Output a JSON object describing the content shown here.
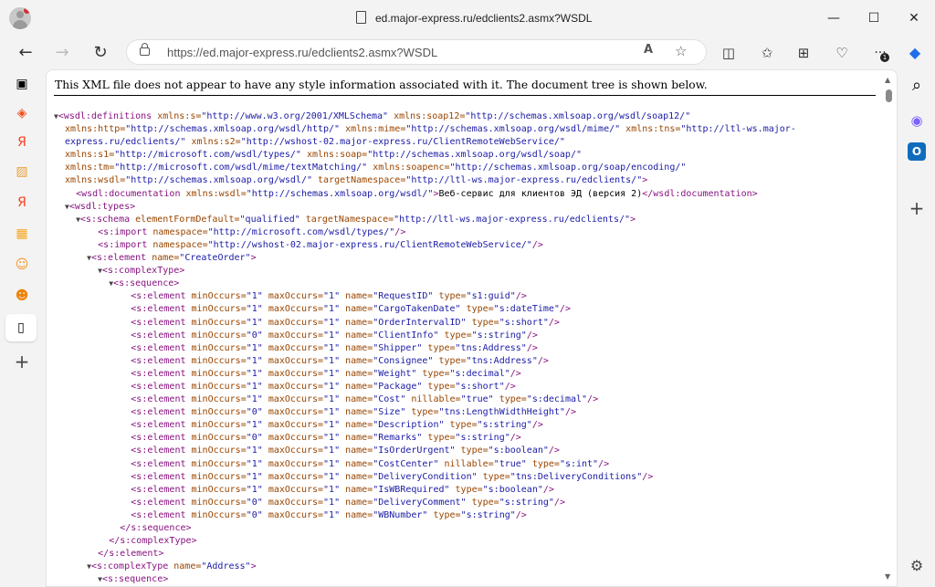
{
  "window": {
    "title": "ed.major-express.ru/edclients2.asmx?WSDL",
    "minimize_glyph": "—",
    "maximize_glyph": "☐",
    "close_glyph": "✕"
  },
  "toolbar": {
    "back_glyph": "←",
    "forward_glyph": "→",
    "refresh_glyph": "↻",
    "url": "https://ed.major-express.ru/edclients2.asmx?WSDL",
    "read_aloud_glyph": "A",
    "favorite_glyph": "☆",
    "split_glyph": "◫",
    "favorites_glyph": "✩",
    "collections_glyph": "⊞",
    "performance_glyph": "♡",
    "more_glyph": "···",
    "notification_badge": "1",
    "copilot_glyph": "◆"
  },
  "sidebar_left": {
    "items": [
      {
        "icon": "tab-actions-icon",
        "glyph": "▣",
        "color": "#222222"
      },
      {
        "icon": "figma-icon",
        "glyph": "◈",
        "color": "#f24e1e"
      },
      {
        "icon": "yandex-icon",
        "glyph": "Я",
        "color": "#fc3f1d"
      },
      {
        "icon": "image-icon",
        "glyph": "▨",
        "color": "#e8a33c"
      },
      {
        "icon": "yandex-icon",
        "glyph": "Я",
        "color": "#fc3f1d"
      },
      {
        "icon": "ok-icon",
        "glyph": "▦",
        "color": "#f5a623"
      },
      {
        "icon": "ok-icon",
        "glyph": "☺",
        "color": "#f7931e"
      },
      {
        "icon": "ok-icon",
        "glyph": "☻",
        "color": "#ee8208"
      },
      {
        "icon": "document-icon",
        "glyph": "▯",
        "color": "#222222"
      },
      {
        "icon": "add-icon",
        "glyph": "+",
        "color": "#444444"
      }
    ]
  },
  "sidebar_right": {
    "items": [
      {
        "icon": "search-icon",
        "glyph": "⌕",
        "color": "#333333"
      },
      {
        "icon": "copilot-icon",
        "glyph": "◉",
        "color": "#7b61ff"
      },
      {
        "icon": "outlook-icon",
        "glyph": "O",
        "color": "#0f6cbd"
      },
      {
        "icon": "add-icon",
        "glyph": "+",
        "color": "#444444"
      },
      {
        "icon": "settings-icon",
        "glyph": "⚙",
        "color": "#444444"
      }
    ]
  },
  "notice": "This XML file does not appear to have any style information associated with it. The document tree is shown below.",
  "xml_lines": [
    [
      {
        "t": "tr",
        "v": "▼"
      },
      {
        "t": "tg",
        "v": "<wsdl:definitions"
      },
      {
        "t": "an",
        "v": " xmlns:s="
      },
      {
        "t": "av",
        "v": "\"http://www.w3.org/2001/XMLSchema\""
      },
      {
        "t": "an",
        "v": " xmlns:soap12="
      },
      {
        "t": "av",
        "v": "\"http://schemas.xmlsoap.org/wsdl/soap12/\""
      }
    ],
    [
      {
        "t": "an",
        "v": "  xmlns:http="
      },
      {
        "t": "av",
        "v": "\"http://schemas.xmlsoap.org/wsdl/http/\""
      },
      {
        "t": "an",
        "v": " xmlns:mime="
      },
      {
        "t": "av",
        "v": "\"http://schemas.xmlsoap.org/wsdl/mime/\""
      },
      {
        "t": "an",
        "v": " xmlns:tns="
      },
      {
        "t": "av",
        "v": "\"http://ltl-ws.major-"
      }
    ],
    [
      {
        "t": "av",
        "v": "  express.ru/edclients/\""
      },
      {
        "t": "an",
        "v": " xmlns:s2="
      },
      {
        "t": "av",
        "v": "\"http://wshost-02.major-express.ru/ClientRemoteWebService/\""
      }
    ],
    [
      {
        "t": "an",
        "v": "  xmlns:s1="
      },
      {
        "t": "av",
        "v": "\"http://microsoft.com/wsdl/types/\""
      },
      {
        "t": "an",
        "v": " xmlns:soap="
      },
      {
        "t": "av",
        "v": "\"http://schemas.xmlsoap.org/wsdl/soap/\""
      }
    ],
    [
      {
        "t": "an",
        "v": "  xmlns:tm="
      },
      {
        "t": "av",
        "v": "\"http://microsoft.com/wsdl/mime/textMatching/\""
      },
      {
        "t": "an",
        "v": " xmlns:soapenc="
      },
      {
        "t": "av",
        "v": "\"http://schemas.xmlsoap.org/soap/encoding/\""
      }
    ],
    [
      {
        "t": "an",
        "v": "  xmlns:wsdl="
      },
      {
        "t": "av",
        "v": "\"http://schemas.xmlsoap.org/wsdl/\""
      },
      {
        "t": "an",
        "v": " targetNamespace="
      },
      {
        "t": "av",
        "v": "\"http://ltl-ws.major-express.ru/edclients/\""
      },
      {
        "t": "tg",
        "v": ">"
      }
    ],
    [
      {
        "t": "tg",
        "v": "    <wsdl:documentation"
      },
      {
        "t": "an",
        "v": " xmlns:wsdl="
      },
      {
        "t": "av",
        "v": "\"http://schemas.xmlsoap.org/wsdl/\""
      },
      {
        "t": "tg",
        "v": ">"
      },
      {
        "t": "tx",
        "v": "Веб-сервис для клиентов ЭД (версия 2)"
      },
      {
        "t": "tg",
        "v": "</wsdl:documentation>"
      }
    ],
    [
      {
        "t": "tx",
        "v": "  "
      },
      {
        "t": "tr",
        "v": "▼"
      },
      {
        "t": "tg",
        "v": "<wsdl:types>"
      }
    ],
    [
      {
        "t": "tx",
        "v": "    "
      },
      {
        "t": "tr",
        "v": "▼"
      },
      {
        "t": "tg",
        "v": "<s:schema"
      },
      {
        "t": "an",
        "v": " elementFormDefault="
      },
      {
        "t": "av",
        "v": "\"qualified\""
      },
      {
        "t": "an",
        "v": " targetNamespace="
      },
      {
        "t": "av",
        "v": "\"http://ltl-ws.major-express.ru/edclients/\""
      },
      {
        "t": "tg",
        "v": ">"
      }
    ],
    [
      {
        "t": "tg",
        "v": "        <s:import"
      },
      {
        "t": "an",
        "v": " namespace="
      },
      {
        "t": "av",
        "v": "\"http://microsoft.com/wsdl/types/\""
      },
      {
        "t": "tg",
        "v": "/>"
      }
    ],
    [
      {
        "t": "tg",
        "v": "        <s:import"
      },
      {
        "t": "an",
        "v": " namespace="
      },
      {
        "t": "av",
        "v": "\"http://wshost-02.major-express.ru/ClientRemoteWebService/\""
      },
      {
        "t": "tg",
        "v": "/>"
      }
    ],
    [
      {
        "t": "tx",
        "v": "      "
      },
      {
        "t": "tr",
        "v": "▼"
      },
      {
        "t": "tg",
        "v": "<s:element"
      },
      {
        "t": "an",
        "v": " name="
      },
      {
        "t": "av",
        "v": "\"CreateOrder\""
      },
      {
        "t": "tg",
        "v": ">"
      }
    ],
    [
      {
        "t": "tx",
        "v": "        "
      },
      {
        "t": "tr",
        "v": "▼"
      },
      {
        "t": "tg",
        "v": "<s:complexType>"
      }
    ],
    [
      {
        "t": "tx",
        "v": "          "
      },
      {
        "t": "tr",
        "v": "▼"
      },
      {
        "t": "tg",
        "v": "<s:sequence>"
      }
    ],
    [
      {
        "t": "tg",
        "v": "              <s:element"
      },
      {
        "t": "an",
        "v": " minOccurs="
      },
      {
        "t": "av",
        "v": "\"1\""
      },
      {
        "t": "an",
        "v": " maxOccurs="
      },
      {
        "t": "av",
        "v": "\"1\""
      },
      {
        "t": "an",
        "v": " name="
      },
      {
        "t": "av",
        "v": "\"RequestID\""
      },
      {
        "t": "an",
        "v": " type="
      },
      {
        "t": "av",
        "v": "\"s1:guid\""
      },
      {
        "t": "tg",
        "v": "/>"
      }
    ],
    [
      {
        "t": "tg",
        "v": "              <s:element"
      },
      {
        "t": "an",
        "v": " minOccurs="
      },
      {
        "t": "av",
        "v": "\"1\""
      },
      {
        "t": "an",
        "v": " maxOccurs="
      },
      {
        "t": "av",
        "v": "\"1\""
      },
      {
        "t": "an",
        "v": " name="
      },
      {
        "t": "av",
        "v": "\"CargoTakenDate\""
      },
      {
        "t": "an",
        "v": " type="
      },
      {
        "t": "av",
        "v": "\"s:dateTime\""
      },
      {
        "t": "tg",
        "v": "/>"
      }
    ],
    [
      {
        "t": "tg",
        "v": "              <s:element"
      },
      {
        "t": "an",
        "v": " minOccurs="
      },
      {
        "t": "av",
        "v": "\"1\""
      },
      {
        "t": "an",
        "v": " maxOccurs="
      },
      {
        "t": "av",
        "v": "\"1\""
      },
      {
        "t": "an",
        "v": " name="
      },
      {
        "t": "av",
        "v": "\"OrderIntervalID\""
      },
      {
        "t": "an",
        "v": " type="
      },
      {
        "t": "av",
        "v": "\"s:short\""
      },
      {
        "t": "tg",
        "v": "/>"
      }
    ],
    [
      {
        "t": "tg",
        "v": "              <s:element"
      },
      {
        "t": "an",
        "v": " minOccurs="
      },
      {
        "t": "av",
        "v": "\"0\""
      },
      {
        "t": "an",
        "v": " maxOccurs="
      },
      {
        "t": "av",
        "v": "\"1\""
      },
      {
        "t": "an",
        "v": " name="
      },
      {
        "t": "av",
        "v": "\"ClientInfo\""
      },
      {
        "t": "an",
        "v": " type="
      },
      {
        "t": "av",
        "v": "\"s:string\""
      },
      {
        "t": "tg",
        "v": "/>"
      }
    ],
    [
      {
        "t": "tg",
        "v": "              <s:element"
      },
      {
        "t": "an",
        "v": " minOccurs="
      },
      {
        "t": "av",
        "v": "\"1\""
      },
      {
        "t": "an",
        "v": " maxOccurs="
      },
      {
        "t": "av",
        "v": "\"1\""
      },
      {
        "t": "an",
        "v": " name="
      },
      {
        "t": "av",
        "v": "\"Shipper\""
      },
      {
        "t": "an",
        "v": " type="
      },
      {
        "t": "av",
        "v": "\"tns:Address\""
      },
      {
        "t": "tg",
        "v": "/>"
      }
    ],
    [
      {
        "t": "tg",
        "v": "              <s:element"
      },
      {
        "t": "an",
        "v": " minOccurs="
      },
      {
        "t": "av",
        "v": "\"1\""
      },
      {
        "t": "an",
        "v": " maxOccurs="
      },
      {
        "t": "av",
        "v": "\"1\""
      },
      {
        "t": "an",
        "v": " name="
      },
      {
        "t": "av",
        "v": "\"Consignee\""
      },
      {
        "t": "an",
        "v": " type="
      },
      {
        "t": "av",
        "v": "\"tns:Address\""
      },
      {
        "t": "tg",
        "v": "/>"
      }
    ],
    [
      {
        "t": "tg",
        "v": "              <s:element"
      },
      {
        "t": "an",
        "v": " minOccurs="
      },
      {
        "t": "av",
        "v": "\"1\""
      },
      {
        "t": "an",
        "v": " maxOccurs="
      },
      {
        "t": "av",
        "v": "\"1\""
      },
      {
        "t": "an",
        "v": " name="
      },
      {
        "t": "av",
        "v": "\"Weight\""
      },
      {
        "t": "an",
        "v": " type="
      },
      {
        "t": "av",
        "v": "\"s:decimal\""
      },
      {
        "t": "tg",
        "v": "/>"
      }
    ],
    [
      {
        "t": "tg",
        "v": "              <s:element"
      },
      {
        "t": "an",
        "v": " minOccurs="
      },
      {
        "t": "av",
        "v": "\"1\""
      },
      {
        "t": "an",
        "v": " maxOccurs="
      },
      {
        "t": "av",
        "v": "\"1\""
      },
      {
        "t": "an",
        "v": " name="
      },
      {
        "t": "av",
        "v": "\"Package\""
      },
      {
        "t": "an",
        "v": " type="
      },
      {
        "t": "av",
        "v": "\"s:short\""
      },
      {
        "t": "tg",
        "v": "/>"
      }
    ],
    [
      {
        "t": "tg",
        "v": "              <s:element"
      },
      {
        "t": "an",
        "v": " minOccurs="
      },
      {
        "t": "av",
        "v": "\"1\""
      },
      {
        "t": "an",
        "v": " maxOccurs="
      },
      {
        "t": "av",
        "v": "\"1\""
      },
      {
        "t": "an",
        "v": " name="
      },
      {
        "t": "av",
        "v": "\"Cost\""
      },
      {
        "t": "an",
        "v": " nillable="
      },
      {
        "t": "av",
        "v": "\"true\""
      },
      {
        "t": "an",
        "v": " type="
      },
      {
        "t": "av",
        "v": "\"s:decimal\""
      },
      {
        "t": "tg",
        "v": "/>"
      }
    ],
    [
      {
        "t": "tg",
        "v": "              <s:element"
      },
      {
        "t": "an",
        "v": " minOccurs="
      },
      {
        "t": "av",
        "v": "\"0\""
      },
      {
        "t": "an",
        "v": " maxOccurs="
      },
      {
        "t": "av",
        "v": "\"1\""
      },
      {
        "t": "an",
        "v": " name="
      },
      {
        "t": "av",
        "v": "\"Size\""
      },
      {
        "t": "an",
        "v": " type="
      },
      {
        "t": "av",
        "v": "\"tns:LengthWidthHeight\""
      },
      {
        "t": "tg",
        "v": "/>"
      }
    ],
    [
      {
        "t": "tg",
        "v": "              <s:element"
      },
      {
        "t": "an",
        "v": " minOccurs="
      },
      {
        "t": "av",
        "v": "\"1\""
      },
      {
        "t": "an",
        "v": " maxOccurs="
      },
      {
        "t": "av",
        "v": "\"1\""
      },
      {
        "t": "an",
        "v": " name="
      },
      {
        "t": "av",
        "v": "\"Description\""
      },
      {
        "t": "an",
        "v": " type="
      },
      {
        "t": "av",
        "v": "\"s:string\""
      },
      {
        "t": "tg",
        "v": "/>"
      }
    ],
    [
      {
        "t": "tg",
        "v": "              <s:element"
      },
      {
        "t": "an",
        "v": " minOccurs="
      },
      {
        "t": "av",
        "v": "\"0\""
      },
      {
        "t": "an",
        "v": " maxOccurs="
      },
      {
        "t": "av",
        "v": "\"1\""
      },
      {
        "t": "an",
        "v": " name="
      },
      {
        "t": "av",
        "v": "\"Remarks\""
      },
      {
        "t": "an",
        "v": " type="
      },
      {
        "t": "av",
        "v": "\"s:string\""
      },
      {
        "t": "tg",
        "v": "/>"
      }
    ],
    [
      {
        "t": "tg",
        "v": "              <s:element"
      },
      {
        "t": "an",
        "v": " minOccurs="
      },
      {
        "t": "av",
        "v": "\"1\""
      },
      {
        "t": "an",
        "v": " maxOccurs="
      },
      {
        "t": "av",
        "v": "\"1\""
      },
      {
        "t": "an",
        "v": " name="
      },
      {
        "t": "av",
        "v": "\"IsOrderUrgent\""
      },
      {
        "t": "an",
        "v": " type="
      },
      {
        "t": "av",
        "v": "\"s:boolean\""
      },
      {
        "t": "tg",
        "v": "/>"
      }
    ],
    [
      {
        "t": "tg",
        "v": "              <s:element"
      },
      {
        "t": "an",
        "v": " minOccurs="
      },
      {
        "t": "av",
        "v": "\"1\""
      },
      {
        "t": "an",
        "v": " maxOccurs="
      },
      {
        "t": "av",
        "v": "\"1\""
      },
      {
        "t": "an",
        "v": " name="
      },
      {
        "t": "av",
        "v": "\"CostCenter\""
      },
      {
        "t": "an",
        "v": " nillable="
      },
      {
        "t": "av",
        "v": "\"true\""
      },
      {
        "t": "an",
        "v": " type="
      },
      {
        "t": "av",
        "v": "\"s:int\""
      },
      {
        "t": "tg",
        "v": "/>"
      }
    ],
    [
      {
        "t": "tg",
        "v": "              <s:element"
      },
      {
        "t": "an",
        "v": " minOccurs="
      },
      {
        "t": "av",
        "v": "\"1\""
      },
      {
        "t": "an",
        "v": " maxOccurs="
      },
      {
        "t": "av",
        "v": "\"1\""
      },
      {
        "t": "an",
        "v": " name="
      },
      {
        "t": "av",
        "v": "\"DeliveryCondition\""
      },
      {
        "t": "an",
        "v": " type="
      },
      {
        "t": "av",
        "v": "\"tns:DeliveryConditions\""
      },
      {
        "t": "tg",
        "v": "/>"
      }
    ],
    [
      {
        "t": "tg",
        "v": "              <s:element"
      },
      {
        "t": "an",
        "v": " minOccurs="
      },
      {
        "t": "av",
        "v": "\"1\""
      },
      {
        "t": "an",
        "v": " maxOccurs="
      },
      {
        "t": "av",
        "v": "\"1\""
      },
      {
        "t": "an",
        "v": " name="
      },
      {
        "t": "av",
        "v": "\"IsWBRequired\""
      },
      {
        "t": "an",
        "v": " type="
      },
      {
        "t": "av",
        "v": "\"s:boolean\""
      },
      {
        "t": "tg",
        "v": "/>"
      }
    ],
    [
      {
        "t": "tg",
        "v": "              <s:element"
      },
      {
        "t": "an",
        "v": " minOccurs="
      },
      {
        "t": "av",
        "v": "\"0\""
      },
      {
        "t": "an",
        "v": " maxOccurs="
      },
      {
        "t": "av",
        "v": "\"1\""
      },
      {
        "t": "an",
        "v": " name="
      },
      {
        "t": "av",
        "v": "\"DeliveryComment\""
      },
      {
        "t": "an",
        "v": " type="
      },
      {
        "t": "av",
        "v": "\"s:string\""
      },
      {
        "t": "tg",
        "v": "/>"
      }
    ],
    [
      {
        "t": "tg",
        "v": "              <s:element"
      },
      {
        "t": "an",
        "v": " minOccurs="
      },
      {
        "t": "av",
        "v": "\"0\""
      },
      {
        "t": "an",
        "v": " maxOccurs="
      },
      {
        "t": "av",
        "v": "\"1\""
      },
      {
        "t": "an",
        "v": " name="
      },
      {
        "t": "av",
        "v": "\"WBNumber\""
      },
      {
        "t": "an",
        "v": " type="
      },
      {
        "t": "av",
        "v": "\"s:string\""
      },
      {
        "t": "tg",
        "v": "/>"
      }
    ],
    [
      {
        "t": "tg",
        "v": "            </s:sequence>"
      }
    ],
    [
      {
        "t": "tg",
        "v": "          </s:complexType>"
      }
    ],
    [
      {
        "t": "tg",
        "v": "        </s:element>"
      }
    ],
    [
      {
        "t": "tx",
        "v": "      "
      },
      {
        "t": "tr",
        "v": "▼"
      },
      {
        "t": "tg",
        "v": "<s:complexType"
      },
      {
        "t": "an",
        "v": " name="
      },
      {
        "t": "av",
        "v": "\"Address\""
      },
      {
        "t": "tg",
        "v": ">"
      }
    ],
    [
      {
        "t": "tx",
        "v": "        "
      },
      {
        "t": "tr",
        "v": "▼"
      },
      {
        "t": "tg",
        "v": "<s:sequence>"
      }
    ]
  ]
}
